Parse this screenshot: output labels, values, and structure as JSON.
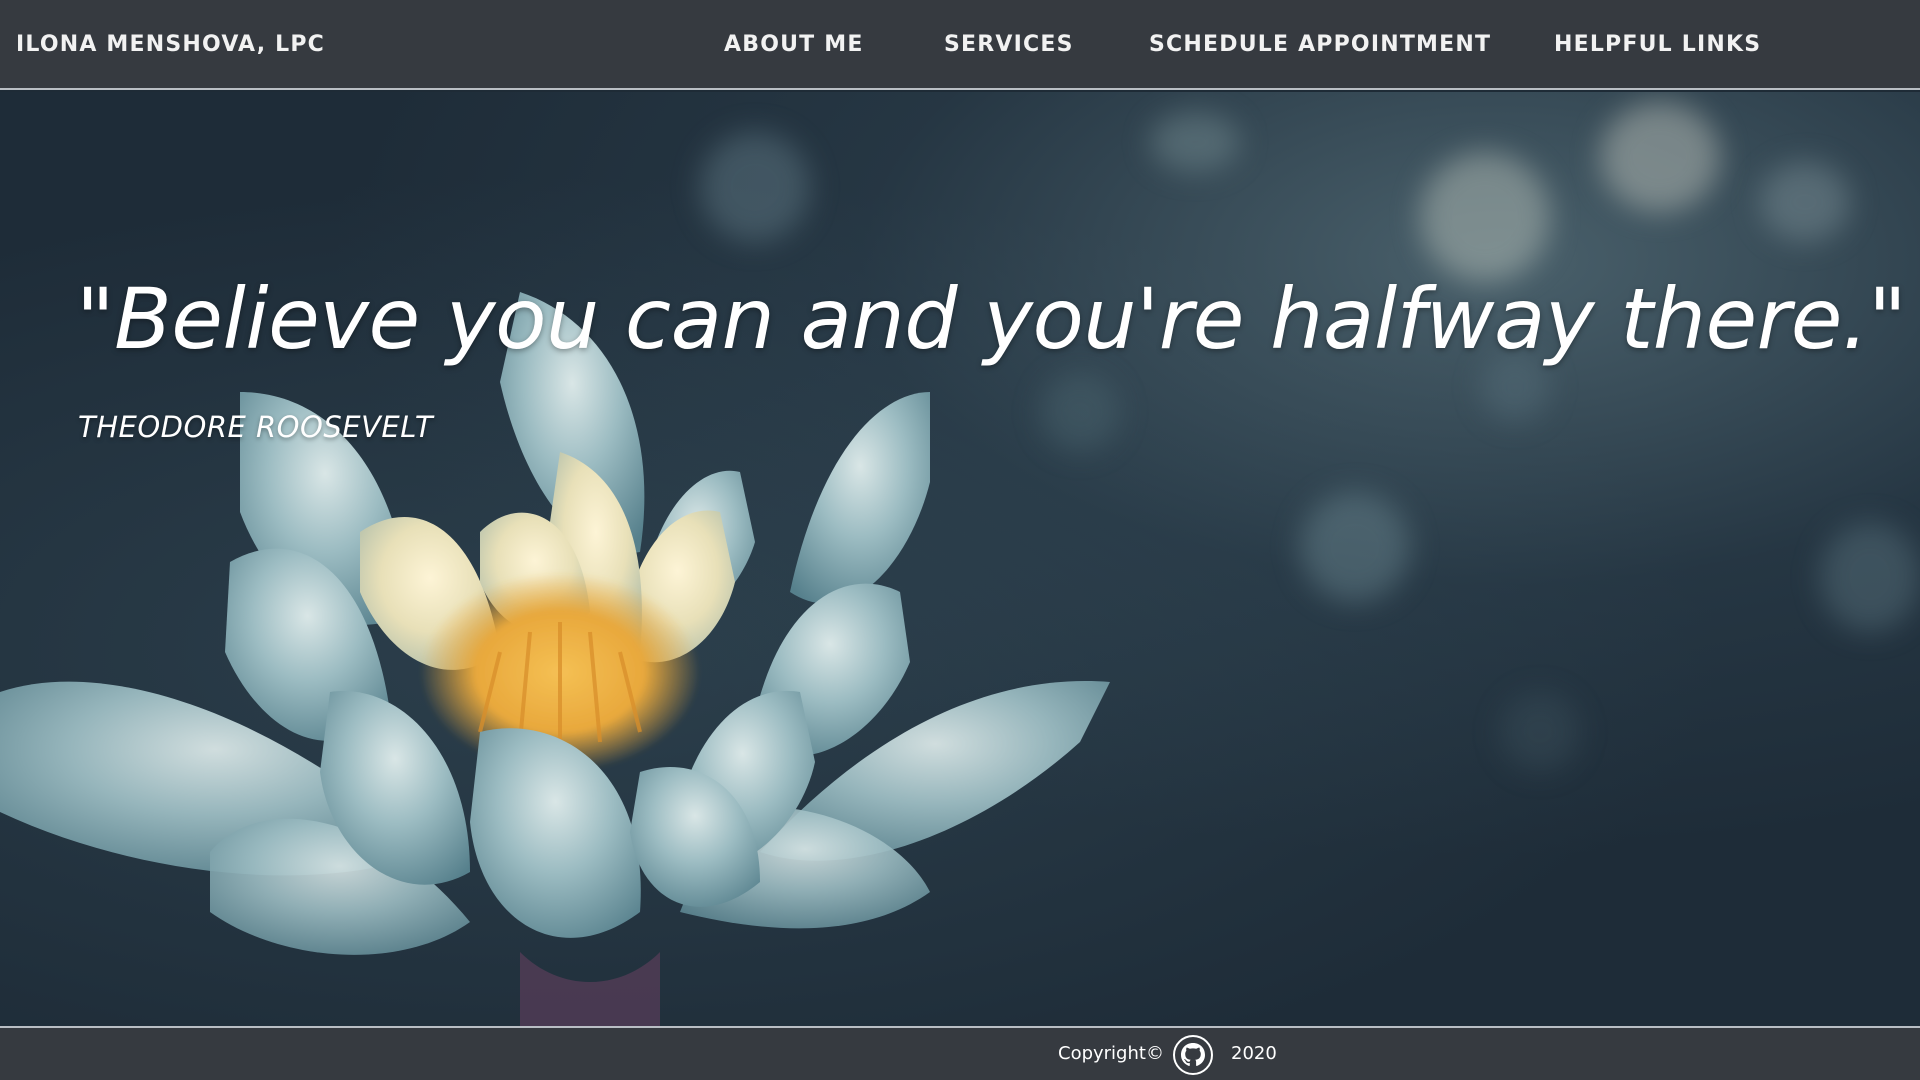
{
  "brand": {
    "name": "ILONA MENSHOVA, LPC"
  },
  "nav": {
    "items": [
      {
        "label": "ABOUT ME"
      },
      {
        "label": "SERVICES"
      },
      {
        "label": "SCHEDULE APPOINTMENT"
      },
      {
        "label": "HELPFUL LINKS"
      }
    ]
  },
  "hero": {
    "quote": "\"Believe you can and you're halfway there.\"",
    "author": "THEODORE ROOSEVELT"
  },
  "footer": {
    "copyright": "Copyright©",
    "year": "2020",
    "icon": "github-icon"
  },
  "colors": {
    "navbar_bg": "#363a40",
    "footer_bg": "#363a40",
    "border": "#b9bec4",
    "text": "#ffffff",
    "hero_bg": "#1e2b36"
  }
}
